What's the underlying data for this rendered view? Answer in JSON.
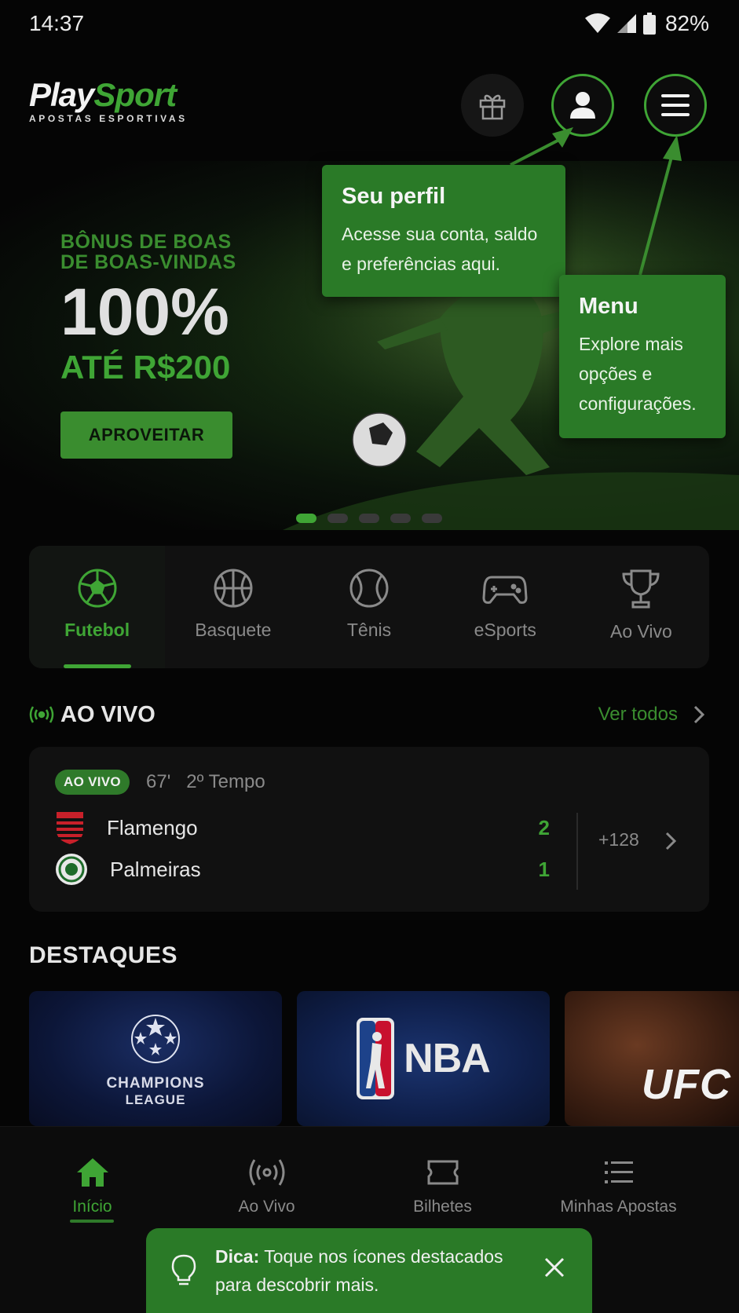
{
  "status_bar": {
    "time": "14:37",
    "battery": "82%"
  },
  "header": {
    "logo_part1": "Play",
    "logo_part2": "Sport",
    "logo_tagline": "APOSTAS ESPORTIVAS",
    "gift_icon": "gift-icon",
    "profile_icon": "user-icon",
    "menu_icon": "hamburger-icon"
  },
  "banner": {
    "bonus_line1": "BÔNUS DE BOAS",
    "bonus_line2": "DE BOAS-VINDAS",
    "percent": "100%",
    "up_to": "ATÉ R$200",
    "cta": "APROVEITAR",
    "slides": 5,
    "active_slide": 1
  },
  "tooltips": {
    "profile": {
      "title": "Seu perfil",
      "text": "Acesse sua conta, saldo e preferências aqui."
    },
    "menu": {
      "title": "Menu",
      "text": "Explore mais opções e configurações."
    }
  },
  "sports": [
    {
      "label": "Futebol",
      "icon": "soccer-ball-icon",
      "active": true
    },
    {
      "label": "Basquete",
      "icon": "basketball-icon",
      "active": false
    },
    {
      "label": "Tênis",
      "icon": "tennis-ball-icon",
      "active": false
    },
    {
      "label": "eSports",
      "icon": "gamepad-icon",
      "active": false
    },
    {
      "label": "Ao Vivo",
      "icon": "trophy-icon",
      "active": false
    }
  ],
  "live_section": {
    "title": "AO VIVO",
    "see_all": "Ver todos",
    "match": {
      "badge": "AO VIVO",
      "minute": "67'",
      "period": "2º Tempo",
      "home_team": "Flamengo",
      "home_score": "2",
      "away_team": "Palmeiras",
      "away_score": "1",
      "more_markets": "+128"
    }
  },
  "destaques": {
    "title": "DESTAQUES",
    "cards": [
      {
        "line1": "CHAMPIONS",
        "line2": "LEAGUE"
      },
      {
        "label": "NBA"
      },
      {
        "label": "UFC"
      }
    ]
  },
  "bottom_nav": [
    {
      "label": "Início",
      "icon": "home-icon",
      "active": true
    },
    {
      "label": "Ao Vivo",
      "icon": "broadcast-icon",
      "active": false
    },
    {
      "label": "Bilhetes",
      "icon": "ticket-icon",
      "active": false
    },
    {
      "label": "Minhas Apostas",
      "icon": "list-icon",
      "active": false
    }
  ],
  "tip_bar": {
    "prefix": "Dica:",
    "text": " Toque nos ícones destacados para descobrir mais."
  },
  "colors": {
    "accent": "#3fa535",
    "tooltip_bg": "#2a7a27",
    "background": "#050505",
    "card_bg": "#111111"
  }
}
